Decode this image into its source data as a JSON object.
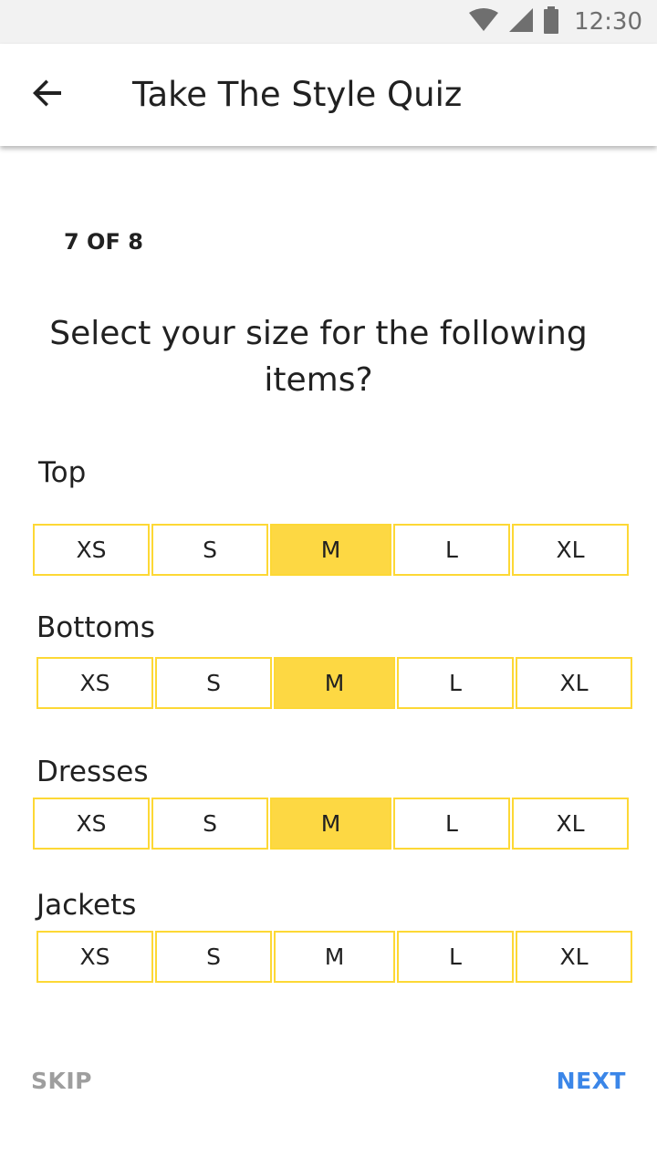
{
  "status_bar": {
    "time": "12:30",
    "icons": [
      "wifi-icon",
      "signal-icon",
      "battery-icon"
    ]
  },
  "app_bar": {
    "back_icon": "arrow-left-icon",
    "title": "Take The Style Quiz"
  },
  "quiz": {
    "progress": "7 OF 8",
    "question": "Select your size for the following items?",
    "size_labels": [
      "XS",
      "S",
      "M",
      "L",
      "XL"
    ],
    "categories": [
      {
        "label": "Top",
        "selected": "M"
      },
      {
        "label": "Bottoms",
        "selected": "M"
      },
      {
        "label": "Dresses",
        "selected": "M"
      },
      {
        "label": "Jackets",
        "selected": null
      }
    ]
  },
  "actions": {
    "skip_label": "SKIP",
    "next_label": "NEXT"
  },
  "colors": {
    "accent_yellow": "#fdd835",
    "selected_fill": "#fdd843",
    "next_blue": "#3b86e8",
    "skip_grey": "#9e9e9e"
  }
}
